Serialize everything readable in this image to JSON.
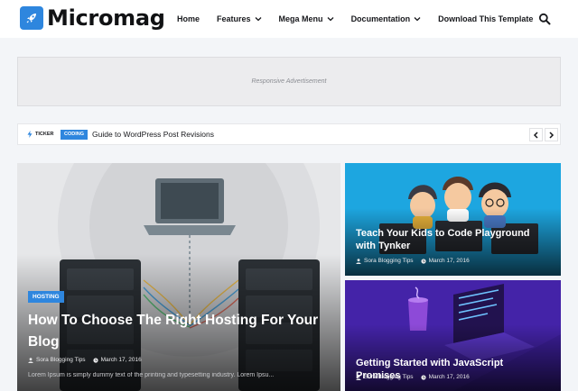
{
  "header": {
    "logo_text": "Micromag",
    "nav": [
      {
        "label": "Home",
        "dropdown": false
      },
      {
        "label": "Features",
        "dropdown": true
      },
      {
        "label": "Mega Menu",
        "dropdown": true
      },
      {
        "label": "Documentation",
        "dropdown": true
      },
      {
        "label": "Download This Template",
        "dropdown": false
      }
    ]
  },
  "ad": {
    "label": "Responsive Advertisement"
  },
  "ticker": {
    "label": "TICKER",
    "category": "CODING",
    "title": "Guide to WordPress Post Revisions"
  },
  "featured": {
    "main": {
      "category": "HOSTING",
      "title": "How To Choose The Right Hosting For Your Blog",
      "author": "Sora Blogging Tips",
      "date": "March 17, 2016",
      "excerpt": "Lorem Ipsum is simply dummy text of the printing and typesetting industry. Lorem Ipsu..."
    },
    "side": [
      {
        "title": "Teach Your Kids to Code Playground with Tynker",
        "author": "Sora Blogging Tips",
        "date": "March 17, 2016"
      },
      {
        "title": "Getting Started with JavaScript Promises",
        "author": "Sora Blogging Tips",
        "date": "March 17, 2016"
      }
    ]
  },
  "colors": {
    "accent": "#2e86de",
    "page_bg": "#f3f5f8",
    "text": "#17181c"
  }
}
